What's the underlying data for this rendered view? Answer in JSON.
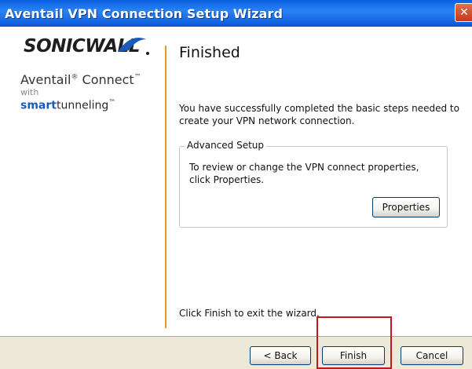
{
  "window": {
    "title": "Aventail VPN Connection Setup Wizard",
    "close_symbol": "✕"
  },
  "brand": {
    "logo_text": "SONICWALL",
    "product_name": "Aventail",
    "product_suffix": "Connect",
    "with_text": "with",
    "smart_prefix": "smart",
    "smart_suffix": "tunneling",
    "accent_color": "#e39a2e",
    "logo_blue": "#1a5bb8"
  },
  "content": {
    "heading": "Finished",
    "description": "You have successfully completed the basic steps needed to create your VPN network connection.",
    "advanced_setup": {
      "title": "Advanced Setup",
      "text": "To review or change the VPN connect properties, click Properties.",
      "properties_button": "Properties"
    },
    "exit_text": "Click Finish to exit the wizard."
  },
  "buttons": {
    "back": "< Back",
    "finish": "Finish",
    "cancel": "Cancel"
  },
  "icons": {
    "close": "close-icon",
    "logo": "sonicwall-swoosh-icon"
  },
  "highlight_color": "#c0181f"
}
